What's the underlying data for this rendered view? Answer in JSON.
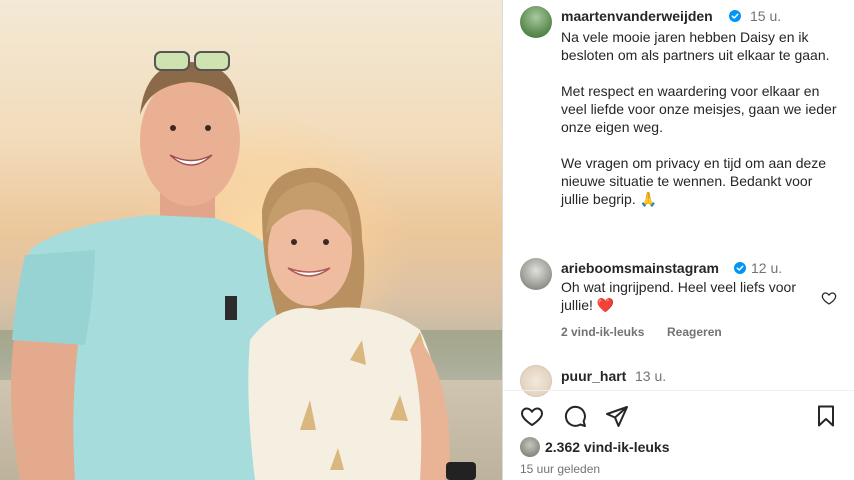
{
  "post": {
    "author": "maartenvanderweijden",
    "author_time": "15 u.",
    "caption_paragraphs": [
      "Na vele mooie jaren hebben Daisy en ik besloten om als partners uit elkaar te gaan.",
      "Met respect en waardering voor elkaar en veel liefde voor onze meisjes, gaan we ieder onze eigen weg.",
      "We vragen om privacy en tijd om aan deze nieuwe situatie te wennen. Bedankt voor jullie begrip. 🙏"
    ]
  },
  "comments": [
    {
      "user": "arieboomsmainstagram",
      "time": "12 u.",
      "text": "Oh wat ingrijpend. Heel veel liefs voor jullie! ❤️",
      "likes_label": "2 vind-ik-leuks",
      "reply_label": "Reageren"
    },
    {
      "user": "puur_hart",
      "time": "13 u."
    }
  ],
  "footer": {
    "likes": "2.362 vind-ik-leuks",
    "posted_ago": "15 uur geleden"
  },
  "icons": {
    "like": "heart-icon",
    "comment": "comment-icon",
    "share": "share-icon",
    "save": "bookmark-icon",
    "verified": "verified-badge-icon",
    "comment_like": "heart-outline-icon"
  },
  "colors": {
    "verified": "#0095f6",
    "text": "#262626",
    "muted": "#737373",
    "heart_emoji": "#e0245e"
  }
}
